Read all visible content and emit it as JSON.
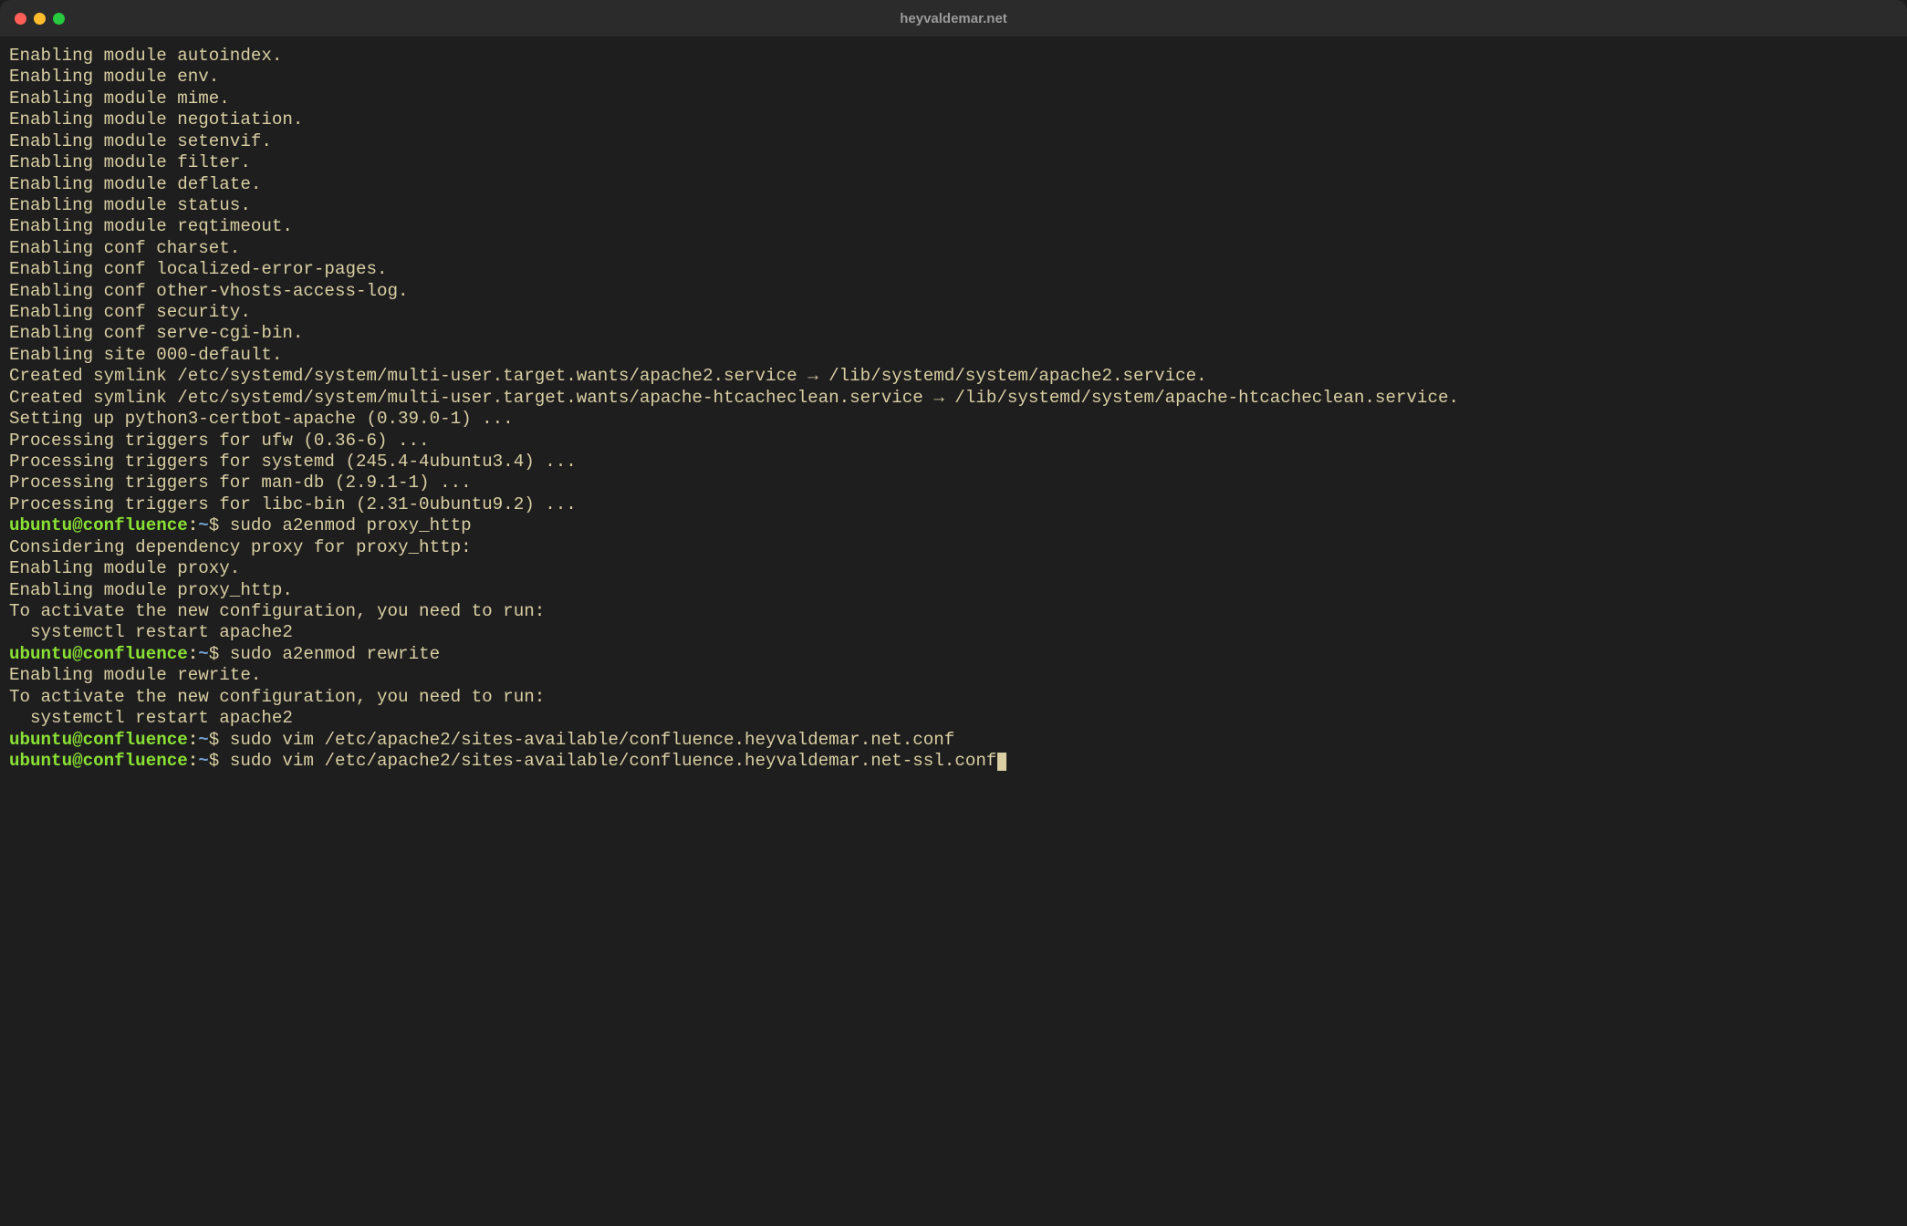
{
  "window": {
    "title": "heyvaldemar.net"
  },
  "prompt": {
    "user": "ubuntu",
    "at": "@",
    "host": "confluence",
    "colon": ":",
    "path": "~",
    "dollar": "$ "
  },
  "lines": [
    {
      "t": "out",
      "text": "Enabling module autoindex."
    },
    {
      "t": "out",
      "text": "Enabling module env."
    },
    {
      "t": "out",
      "text": "Enabling module mime."
    },
    {
      "t": "out",
      "text": "Enabling module negotiation."
    },
    {
      "t": "out",
      "text": "Enabling module setenvif."
    },
    {
      "t": "out",
      "text": "Enabling module filter."
    },
    {
      "t": "out",
      "text": "Enabling module deflate."
    },
    {
      "t": "out",
      "text": "Enabling module status."
    },
    {
      "t": "out",
      "text": "Enabling module reqtimeout."
    },
    {
      "t": "out",
      "text": "Enabling conf charset."
    },
    {
      "t": "out",
      "text": "Enabling conf localized-error-pages."
    },
    {
      "t": "out",
      "text": "Enabling conf other-vhosts-access-log."
    },
    {
      "t": "out",
      "text": "Enabling conf security."
    },
    {
      "t": "out",
      "text": "Enabling conf serve-cgi-bin."
    },
    {
      "t": "out",
      "text": "Enabling site 000-default."
    },
    {
      "t": "out",
      "text": "Created symlink /etc/systemd/system/multi-user.target.wants/apache2.service → /lib/systemd/system/apache2.service."
    },
    {
      "t": "out",
      "text": "Created symlink /etc/systemd/system/multi-user.target.wants/apache-htcacheclean.service → /lib/systemd/system/apache-htcacheclean.service."
    },
    {
      "t": "out",
      "text": "Setting up python3-certbot-apache (0.39.0-1) ..."
    },
    {
      "t": "out",
      "text": "Processing triggers for ufw (0.36-6) ..."
    },
    {
      "t": "out",
      "text": "Processing triggers for systemd (245.4-4ubuntu3.4) ..."
    },
    {
      "t": "out",
      "text": "Processing triggers for man-db (2.9.1-1) ..."
    },
    {
      "t": "out",
      "text": "Processing triggers for libc-bin (2.31-0ubuntu9.2) ..."
    },
    {
      "t": "cmd",
      "text": "sudo a2enmod proxy_http"
    },
    {
      "t": "out",
      "text": "Considering dependency proxy for proxy_http:"
    },
    {
      "t": "out",
      "text": "Enabling module proxy."
    },
    {
      "t": "out",
      "text": "Enabling module proxy_http."
    },
    {
      "t": "out",
      "text": "To activate the new configuration, you need to run:"
    },
    {
      "t": "out",
      "text": "  systemctl restart apache2"
    },
    {
      "t": "cmd",
      "text": "sudo a2enmod rewrite"
    },
    {
      "t": "out",
      "text": "Enabling module rewrite."
    },
    {
      "t": "out",
      "text": "To activate the new configuration, you need to run:"
    },
    {
      "t": "out",
      "text": "  systemctl restart apache2"
    },
    {
      "t": "cmd",
      "text": "sudo vim /etc/apache2/sites-available/confluence.heyvaldemar.net.conf"
    },
    {
      "t": "cmd",
      "text": "sudo vim /etc/apache2/sites-available/confluence.heyvaldemar.net-ssl.conf",
      "cursor": true
    }
  ]
}
